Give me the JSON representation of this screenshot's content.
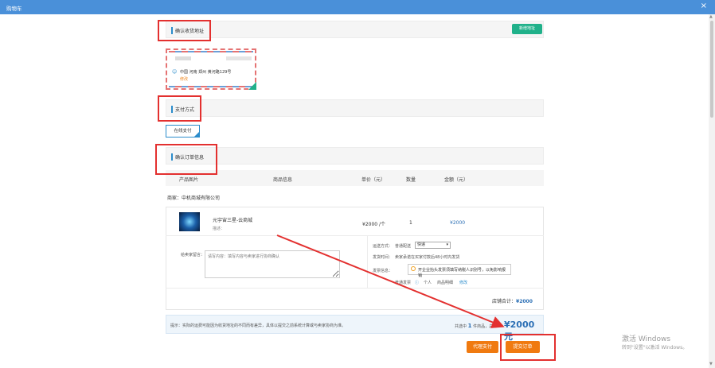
{
  "window": {
    "title": "购物车",
    "close": "×"
  },
  "address_section": {
    "title": "确认收货地址",
    "new_button": "新增地址"
  },
  "address_card": {
    "address": "中国 河南 郑州 黄河路129号",
    "edit": "修改"
  },
  "payment_section": {
    "title": "支付方式",
    "option": "在线支付"
  },
  "order_section": {
    "title": "确认订单信息"
  },
  "table": {
    "headers": [
      "产品图片",
      "商品信息",
      "单价（元）",
      "数量",
      "金额（元）"
    ]
  },
  "merchant": "商家：中机商城有限公司",
  "item": {
    "name": "元宇宙三星-云商城",
    "desc": "描述：",
    "price": "¥2000 /个",
    "qty": "1",
    "amount": "¥2000"
  },
  "message": {
    "label": "给卖家留言：",
    "placeholder": "请写内容：填写内容与卖家进行协商确认"
  },
  "shipping": {
    "method_label": "运送方式：",
    "method_value": "普通配送",
    "method_select": "快递",
    "time_label": "发货时间：",
    "time_value": "卖家承诺在买家付款后48小时内发货",
    "invoice_label": "发票信息：",
    "invoice_value": "开企业抬头发票须填写纳税人识别号，以免影响报销",
    "invoice_type_label": "普通发票",
    "invoice_personal": "个人",
    "invoice_detail": "商品明细",
    "invoice_edit": "修改"
  },
  "subtotal": {
    "label": "店铺合计：",
    "value": "¥2000"
  },
  "tip": {
    "text": "提示：实际的运费可能因为收货地址的不同而有差异，具体以提交之前系统计算或与卖家协商为准。",
    "count_prefix": "共选中",
    "count": "1",
    "count_suffix": "件商品，总价",
    "total": "¥2000元"
  },
  "buttons": {
    "proxy_pay": "代理支付",
    "submit": "提交订单"
  },
  "watermark": {
    "line1": "激活 Windows",
    "line2": "转到\"设置\"以激活 Windows。"
  },
  "colors": {
    "titlebar": "#4a90d9",
    "accent": "#2b8ccb",
    "orange": "#f07a10",
    "annotation_red": "#e3302f",
    "green": "#20b18a"
  }
}
